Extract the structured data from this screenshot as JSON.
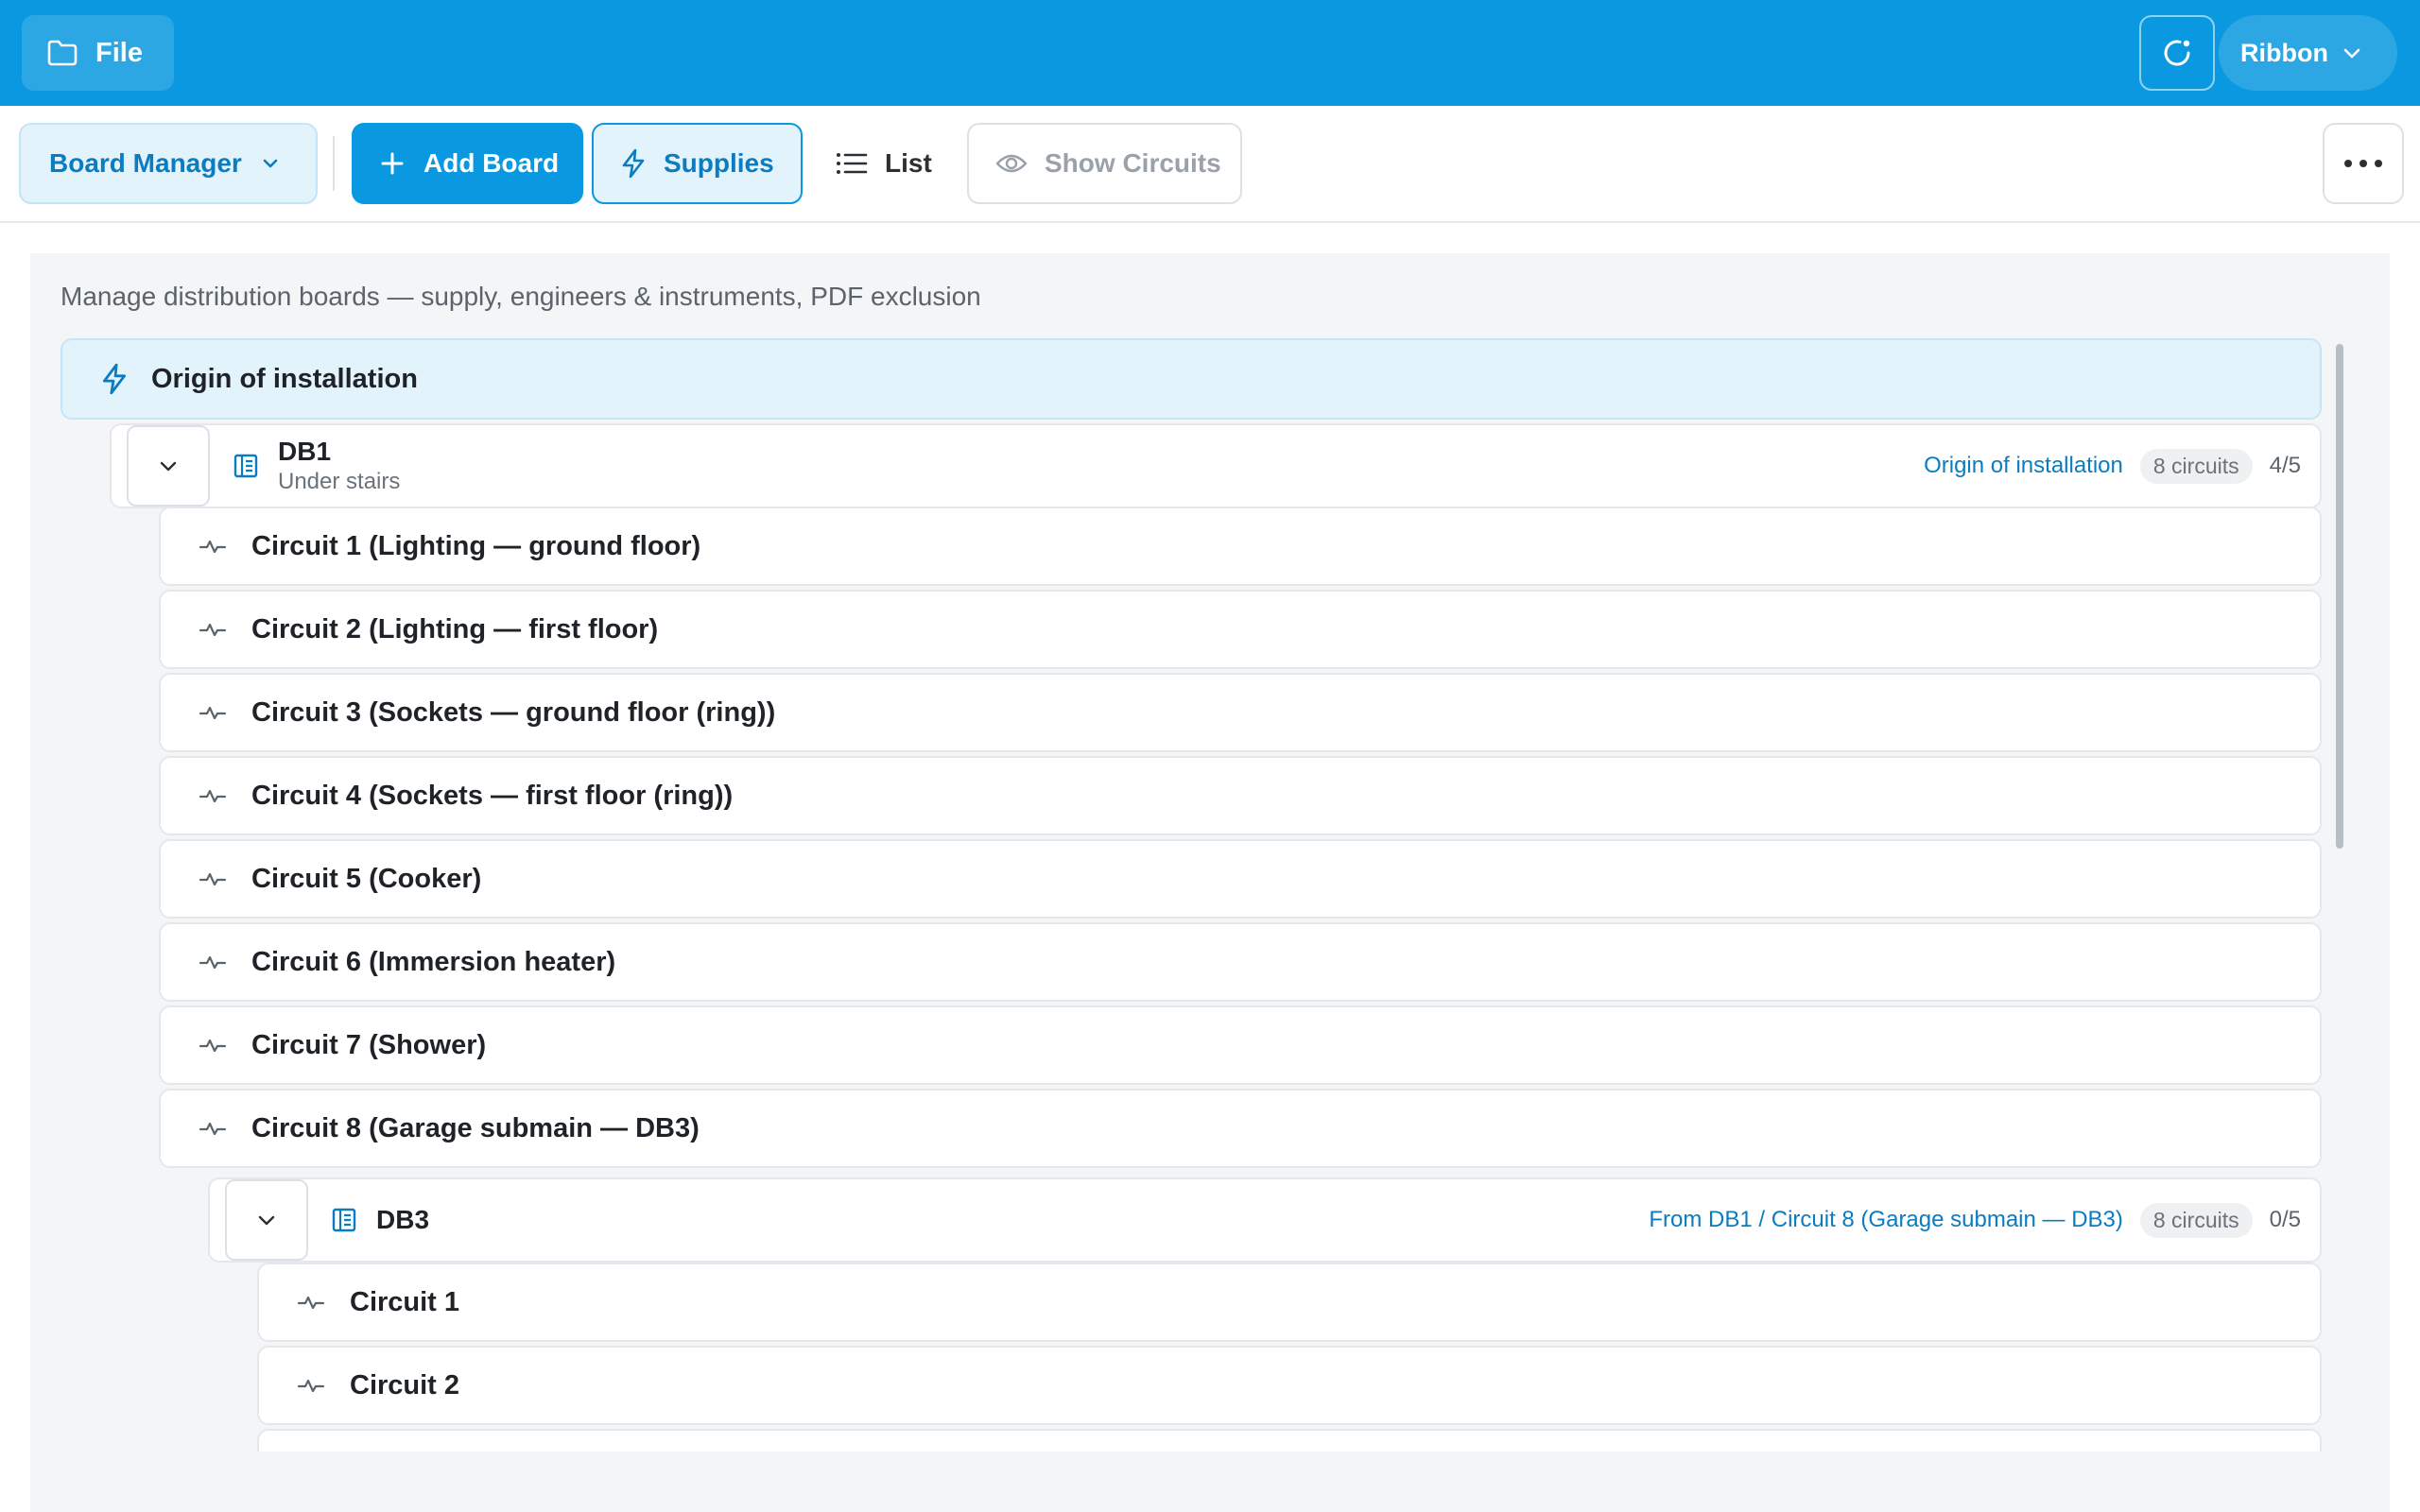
{
  "topbar": {
    "file_label": "File",
    "ribbon_label": "Ribbon",
    "color": "#0a99e0"
  },
  "toolbar": {
    "board_manager_label": "Board Manager",
    "add_board_label": "Add Board",
    "supplies_label": "Supplies",
    "list_label": "List",
    "show_circuits_label": "Show Circuits"
  },
  "panel": {
    "description": "Manage distribution boards — supply, engineers & instruments, PDF exclusion",
    "origin_label": "Origin of installation",
    "boards": [
      {
        "name": "DB1",
        "location": "Under stairs",
        "source": "Origin of installation",
        "circuits_badge": "8 circuits",
        "progress": "4/5",
        "circuits": [
          "Circuit 1 (Lighting — ground floor)",
          "Circuit 2 (Lighting — first floor)",
          "Circuit 3 (Sockets — ground floor (ring))",
          "Circuit 4 (Sockets — first floor (ring))",
          "Circuit 5 (Cooker)",
          "Circuit 6 (Immersion heater)",
          "Circuit 7 (Shower)",
          "Circuit 8 (Garage submain — DB3)"
        ]
      },
      {
        "name": "DB3",
        "source": "From DB1 / Circuit 8 (Garage submain — DB3)",
        "circuits_badge": "8 circuits",
        "progress": "0/5",
        "circuits": [
          "Circuit 1",
          "Circuit 2"
        ]
      }
    ]
  },
  "icons": {
    "file": "folder-icon",
    "refresh": "refresh-icon",
    "ribbon": "chevron-down-icon",
    "board_manager": "chevron-down-icon",
    "add_board": "plus-icon",
    "supplies": "lightning-icon",
    "list": "list-icon",
    "show_circuits": "eye-icon",
    "more": "more-icon",
    "origin": "lightning-icon",
    "board": "board-icon",
    "circuit": "pulse-icon"
  }
}
